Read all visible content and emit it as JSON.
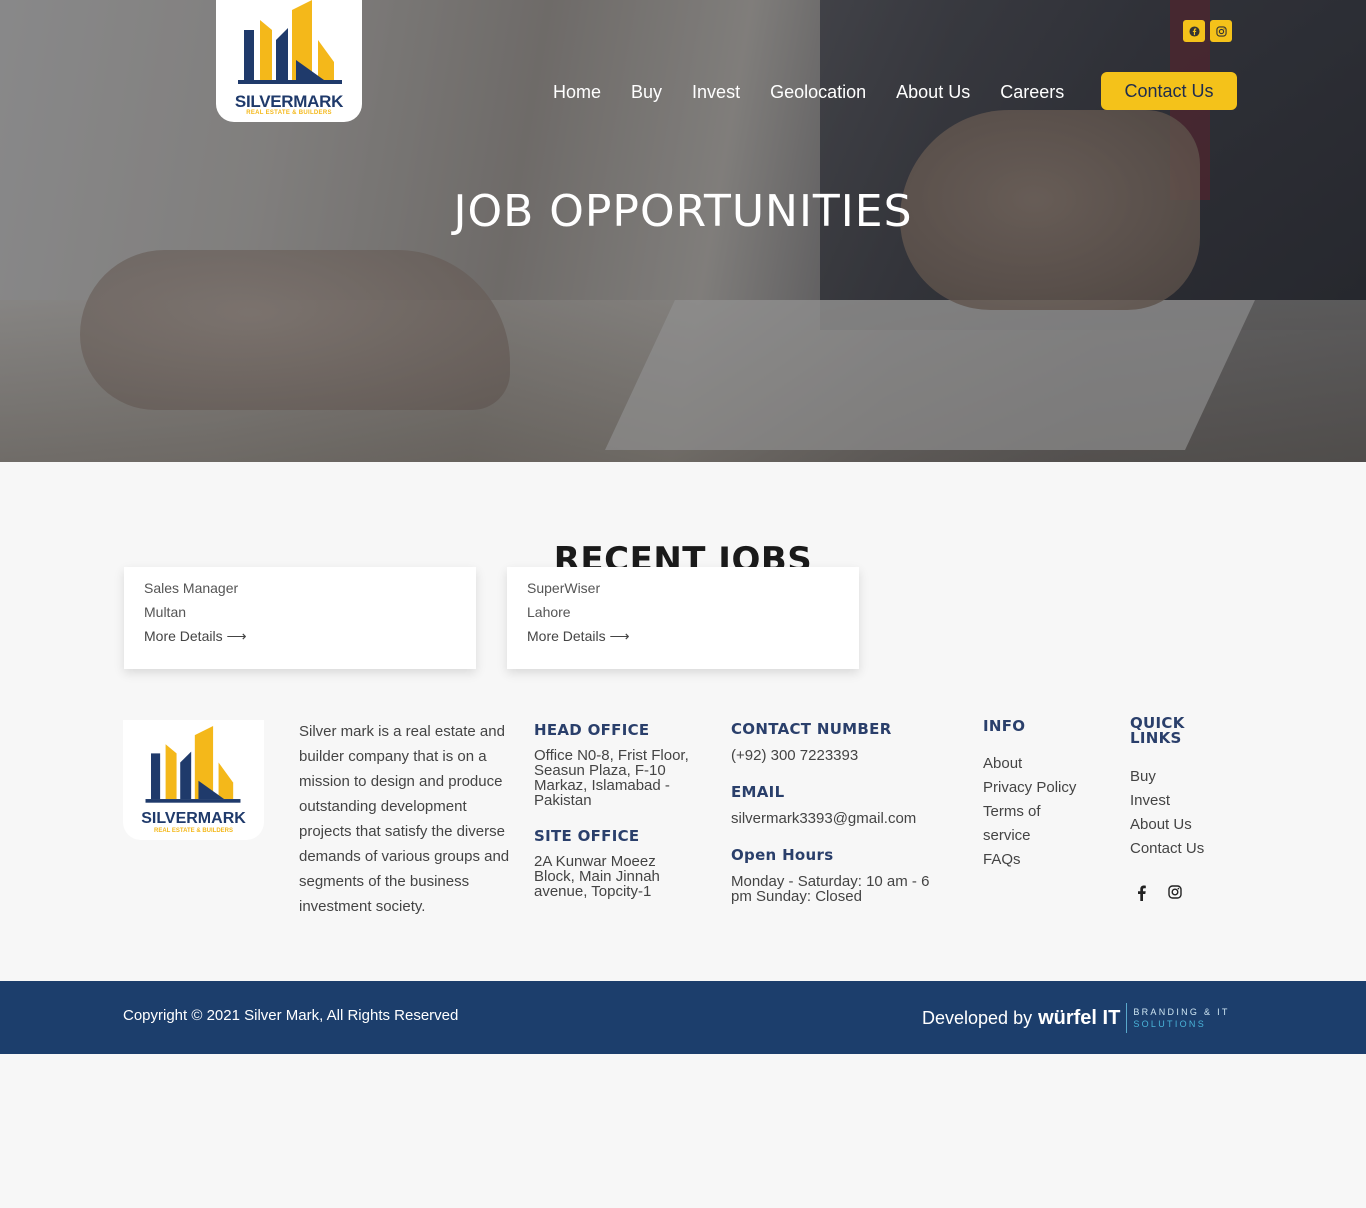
{
  "brand": {
    "name": "SILVERMARK",
    "tagline": "REAL ESTATE & BUILDERS"
  },
  "header": {
    "social_icons": [
      "facebook-icon",
      "instagram-icon"
    ],
    "nav": [
      "Home",
      "Buy",
      "Invest",
      "Geolocation",
      "About Us",
      "Careers"
    ],
    "cta": "Contact Us"
  },
  "hero": {
    "title": "JOB OPPORTUNITIES"
  },
  "jobs": {
    "title": "RECENT JOBS",
    "items": [
      {
        "title": "Sales Manager",
        "location": "Multan",
        "link": "More Details ⟶"
      },
      {
        "title": "SuperWiser",
        "location": "Lahore",
        "link": "More Details ⟶"
      }
    ]
  },
  "footer": {
    "about": "Silver mark is a real estate and builder company that is on a mission to design and produce outstanding development projects that satisfy the diverse demands of various groups and segments of the business investment society.",
    "head_office": {
      "label": "HEAD OFFICE",
      "text": "Office N0-8, Frist Floor, Seasun Plaza, F-10 Markaz, Islamabad - Pakistan"
    },
    "site_office": {
      "label": "SITE OFFICE",
      "text": "2A Kunwar Moeez Block, Main Jinnah avenue, Topcity-1"
    },
    "contact": {
      "label": "CONTACT NUMBER",
      "value": "(+92) 300 7223393"
    },
    "email": {
      "label": "EMAIL",
      "value": "silvermark3393@gmail.com"
    },
    "hours": {
      "label": "Open Hours",
      "value": "Monday - Saturday: 10 am - 6 pm Sunday: Closed"
    },
    "info": {
      "label": "INFO",
      "links": [
        "About",
        "Privacy Policy",
        "Terms of service",
        "FAQs"
      ]
    },
    "quick": {
      "label": "QUICK LINKS",
      "links": [
        "Buy",
        "Invest",
        "About Us",
        "Contact Us"
      ]
    },
    "social_icons": [
      "facebook-icon",
      "instagram-icon"
    ]
  },
  "bottom": {
    "copyright": "Copyright © 2021 Silver Mark, All Rights Reserved",
    "developed_by": "Developed by",
    "dev_brand": "würfel IT",
    "dev_tag_1": "BRANDING & IT",
    "dev_tag_2": "SOLUTIONS"
  }
}
